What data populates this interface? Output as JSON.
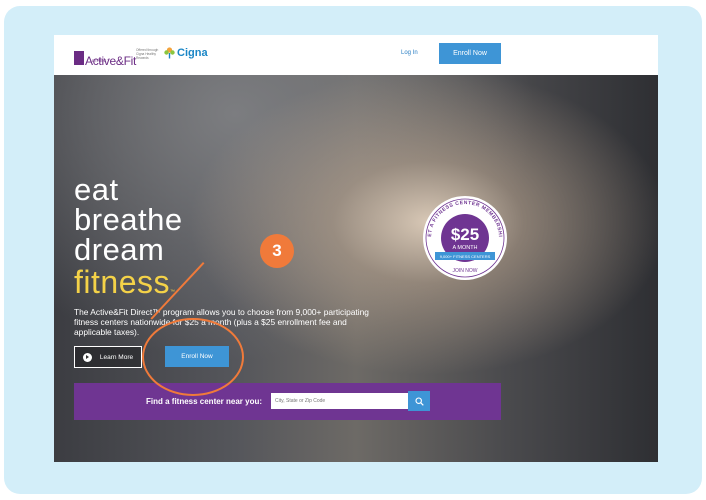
{
  "header": {
    "logo": "Active&Fit",
    "logo_sub": "DIRECT",
    "partner_note": "Offered through Cigna Healthy Rewards",
    "partner": "Cigna",
    "login_label": "Log In",
    "enroll_label": "Enroll Now"
  },
  "hero": {
    "tagline": [
      "eat",
      "breathe",
      "dream",
      "fitness"
    ],
    "tagline_trademark": "™",
    "description": "The Active&Fit Direct™ program allows you to choose from 9,000+ participating fitness centers nationwide for $25 a month (plus a $25 enrollment fee and applicable taxes).",
    "learn_more_label": "Learn More",
    "enroll_label": "Enroll Now",
    "finder_label": "Find a fitness center near you:",
    "search_placeholder": "City, State or Zip Code"
  },
  "badge": {
    "arc_top": "GET A FITNESS CENTER MEMBERSHIP",
    "price": "$25",
    "per": "A MONTH",
    "ribbon": "9,000+ FITNESS CENTERS",
    "join": "JOIN NOW"
  },
  "callout": {
    "number": "3"
  },
  "colors": {
    "frame": "#d3eef9",
    "brand_purple": "#6f3592",
    "enroll_blue": "#3e95d6",
    "tagline_yellow": "#f4d248",
    "callout_orange": "#f07a3a",
    "cigna_blue": "#1a86c6"
  },
  "icons": [
    "play-icon",
    "search-icon",
    "cigna-tree-icon",
    "active-fit-logo-icon"
  ]
}
